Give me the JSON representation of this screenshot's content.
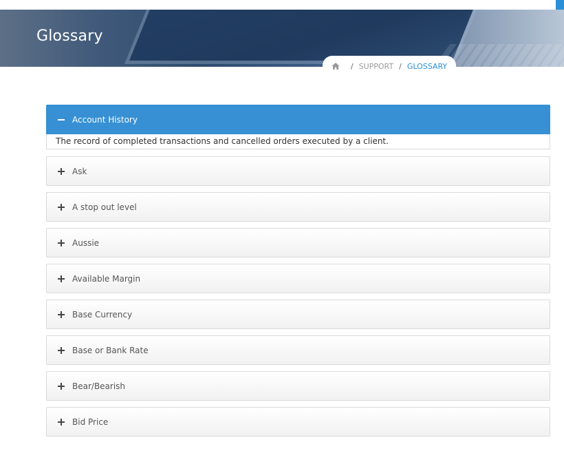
{
  "header": {
    "title": "Glossary"
  },
  "breadcrumb": {
    "home_icon": "home-icon",
    "items": [
      "SUPPORT",
      "GLOSSARY"
    ],
    "separator": "/"
  },
  "colors": {
    "accent": "#3790d4",
    "active_breadcrumb": "#2b8fd6"
  },
  "accordion": {
    "open": {
      "title": "Account History",
      "icon": "minus-icon",
      "body": "The record of completed transactions and cancelled orders executed by a client."
    },
    "items": [
      {
        "title": "Ask",
        "icon": "plus-icon"
      },
      {
        "title": "A stop out level",
        "icon": "plus-icon"
      },
      {
        "title": "Aussie",
        "icon": "plus-icon"
      },
      {
        "title": "Available Margin",
        "icon": "plus-icon"
      },
      {
        "title": "Base Currency",
        "icon": "plus-icon"
      },
      {
        "title": "Base or Bank Rate",
        "icon": "plus-icon"
      },
      {
        "title": "Bear/Bearish",
        "icon": "plus-icon"
      },
      {
        "title": "Bid Price",
        "icon": "plus-icon"
      }
    ]
  }
}
